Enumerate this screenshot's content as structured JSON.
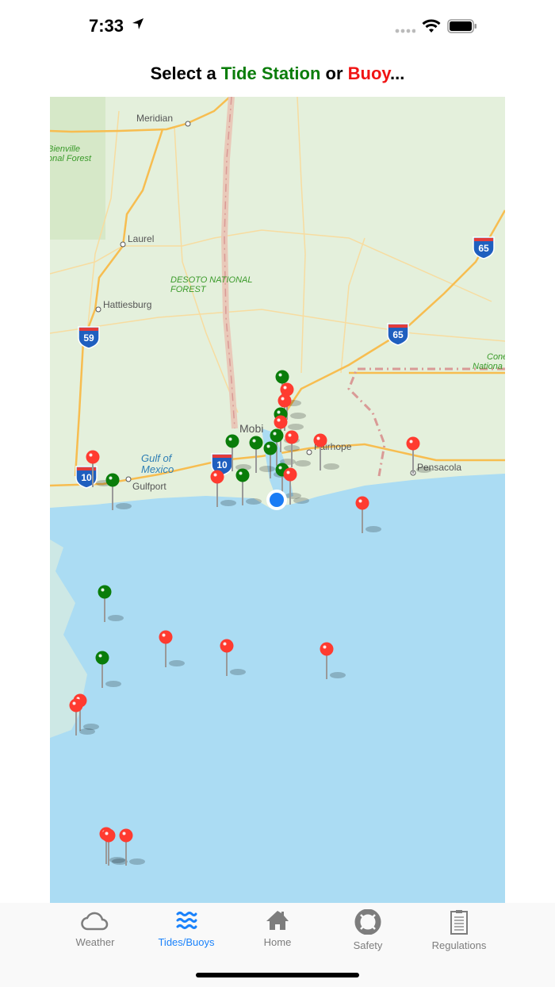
{
  "status_bar": {
    "time": "7:33"
  },
  "header": {
    "prefix": "Select a ",
    "tide": "Tide Station",
    "middle": " or ",
    "buoy": "Buoy",
    "suffix": "..."
  },
  "map": {
    "labels": {
      "meridian": "Meridian",
      "laurel": "Laurel",
      "hattiesburg": "Hattiesburg",
      "bienville1": "Bienville",
      "bienville2": "onal Forest",
      "desoto1": "DESOTO NATIONAL",
      "desoto2": "FOREST",
      "mobile": "Mobi",
      "fairhope": "Fairhope",
      "pensacola": "Pensacola",
      "gulfport": "Gulfport",
      "gulf1": "Gulf of",
      "gulf2": "Mexico",
      "cone1": "Cone",
      "cone2": "Nationa"
    },
    "shields": {
      "i59": "59",
      "i65a": "65",
      "i65b": "65",
      "i10a": "10",
      "i10b": "10"
    },
    "colors": {
      "tide": "#0a7d0a",
      "buoy": "#ff3b30",
      "user": "#1a7cf5",
      "land": "#e4f0dc",
      "sea": "#abdcf3"
    }
  },
  "tabs": [
    {
      "label": "Weather",
      "icon": "cloud-icon"
    },
    {
      "label": "Tides/Buoys",
      "icon": "waves-icon",
      "active": true
    },
    {
      "label": "Home",
      "icon": "house-icon"
    },
    {
      "label": "Safety",
      "icon": "lifebuoy-icon"
    },
    {
      "label": "Regulations",
      "icon": "clipboard-icon"
    }
  ]
}
